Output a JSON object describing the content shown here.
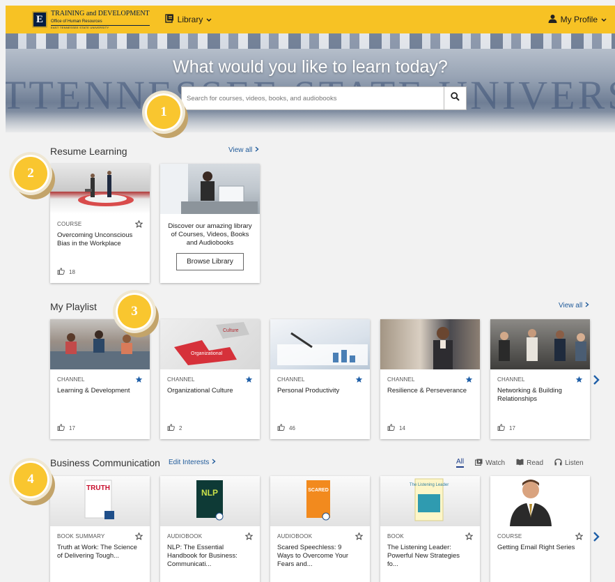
{
  "header": {
    "logo_badge": "E",
    "logo_line1": "TRAINING and DEVELOPMENT",
    "logo_line2": "Office of Human Resources",
    "logo_line3": "EAST TENNESSEE STATE UNIVERSITY",
    "library_label": "Library",
    "profile_label": "My Profile",
    "bar_color": "#f7c224"
  },
  "hero": {
    "title": "What would you like to learn today?",
    "background_text": "TTENNESSEE STATE UNIVERS",
    "search_placeholder": "Search for courses, videos, books, and audiobooks"
  },
  "markers": [
    "1",
    "2",
    "3",
    "4"
  ],
  "resume": {
    "title": "Resume Learning",
    "view_all": "View all",
    "course": {
      "type": "COURSE",
      "title": "Overcoming Unconscious Bias in the Workplace",
      "likes": "18"
    },
    "promo": {
      "text": "Discover our amazing library of Courses, Videos, Books and Audiobooks",
      "button": "Browse Library"
    }
  },
  "playlist": {
    "title": "My Playlist",
    "view_all": "View all",
    "cards": [
      {
        "type": "CHANNEL",
        "title": "Learning & Development",
        "likes": "17"
      },
      {
        "type": "CHANNEL",
        "title": "Organizational Culture",
        "likes": "2",
        "image_words": [
          "Culture",
          "Organizational"
        ]
      },
      {
        "type": "CHANNEL",
        "title": "Personal Productivity",
        "likes": "46"
      },
      {
        "type": "CHANNEL",
        "title": "Resilience & Perseverance",
        "likes": "14"
      },
      {
        "type": "CHANNEL",
        "title": "Networking & Building Relationships",
        "likes": "17"
      }
    ]
  },
  "business": {
    "title": "Business Communication",
    "edit_interests": "Edit Interests",
    "filters": [
      "All",
      "Watch",
      "Read",
      "Listen"
    ],
    "active_filter": "All",
    "cards": [
      {
        "type": "BOOK SUMMARY",
        "title": "Truth at Work: The Science of Delivering Tough...",
        "cover_text": "TRUTH"
      },
      {
        "type": "AUDIOBOOK",
        "title": "NLP: The Essential Handbook for Business: Communicati...",
        "cover_text": "NLP"
      },
      {
        "type": "AUDIOBOOK",
        "title": "Scared Speechless: 9 Ways to Overcome Your Fears and...",
        "cover_text": "SCARED"
      },
      {
        "type": "BOOK",
        "title": "The Listening Leader: Powerful New Strategies fo...",
        "cover_text": "The Listening Leader"
      },
      {
        "type": "COURSE",
        "title": "Getting Email Right Series"
      }
    ]
  },
  "colors": {
    "accent_yellow": "#f9c62f",
    "link_blue": "#1f5a9a",
    "star_filled": "#1f5fa8",
    "arrow_blue": "#1f5fa8"
  }
}
